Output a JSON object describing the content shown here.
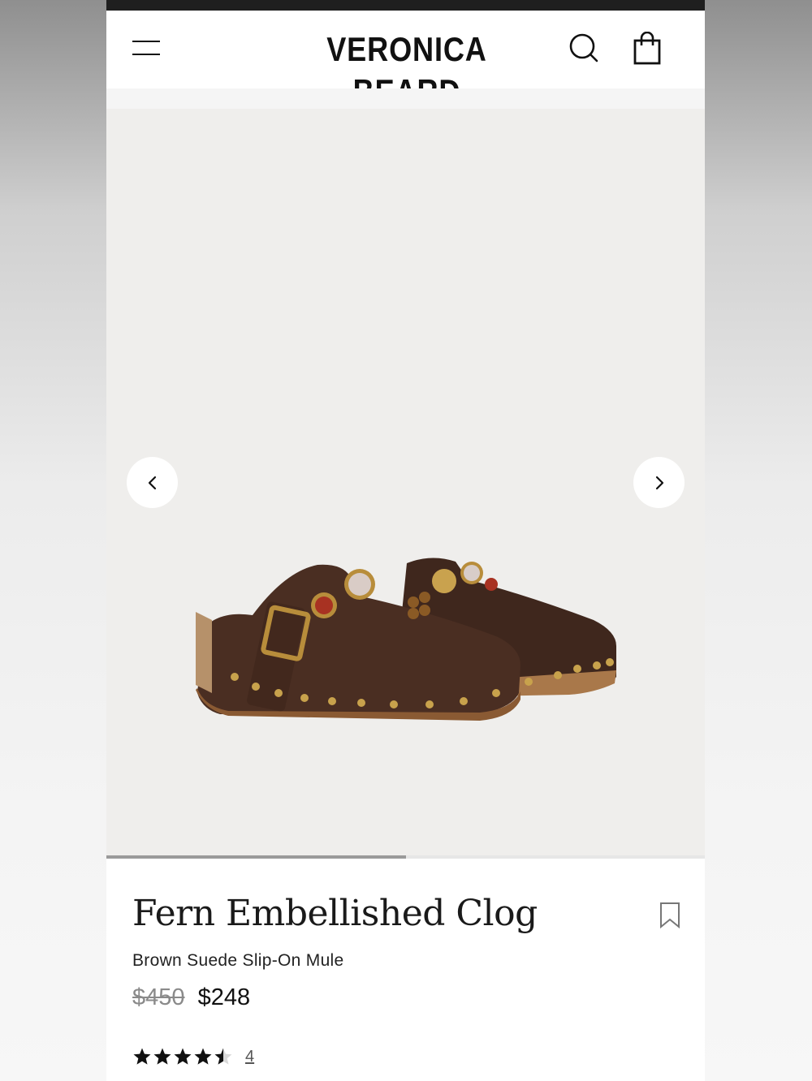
{
  "header": {
    "brand": "VERONICA BEARD",
    "menu_icon": "hamburger-menu-icon",
    "search_icon": "search-icon",
    "cart_icon": "shopping-bag-icon"
  },
  "gallery": {
    "prev_icon": "chevron-left-icon",
    "next_icon": "chevron-right-icon",
    "image_alt": "Brown suede studded clogs with embellishments",
    "progress": 0.5
  },
  "product": {
    "title": "Fern Embellished Clog",
    "subtitle": "Brown Suede Slip-On Mule",
    "price_original": "$450",
    "price_sale": "$248",
    "wishlist_icon": "bookmark-icon",
    "rating": 4.5,
    "review_count": "4"
  },
  "colors": {
    "text": "#111111",
    "muted": "#8a8a8a",
    "gallery_bg": "#efeeec",
    "suede": "#4a2e22",
    "gold": "#b88d3b"
  }
}
